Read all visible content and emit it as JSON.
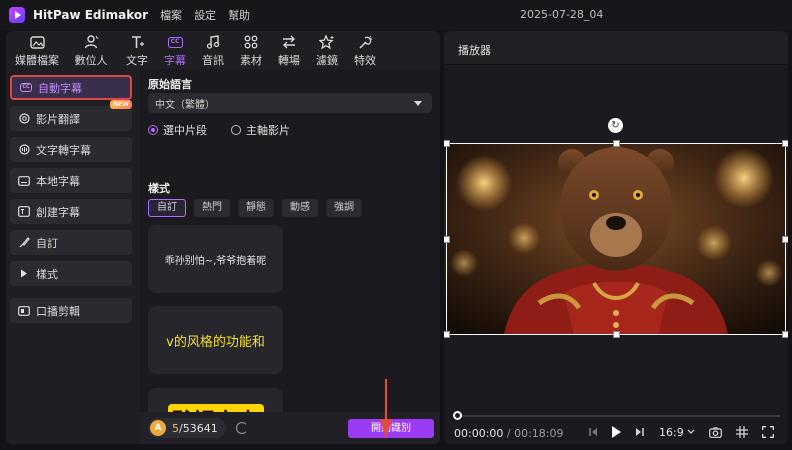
{
  "app": {
    "name": "HitPaw Edimakor",
    "menu": [
      "檔案",
      "設定",
      "幫助"
    ],
    "project_title": "2025-07-28_04"
  },
  "toolbar": {
    "items": [
      {
        "label": "媒體檔案",
        "icon": "media-icon"
      },
      {
        "label": "數位人",
        "icon": "avatar-icon"
      },
      {
        "label": "文字",
        "icon": "text-icon"
      },
      {
        "label": "字幕",
        "icon": "cc-icon",
        "active": true
      },
      {
        "label": "音訊",
        "icon": "music-icon"
      },
      {
        "label": "素材",
        "icon": "sticker-icon"
      },
      {
        "label": "轉場",
        "icon": "transition-icon"
      },
      {
        "label": "濾鏡",
        "icon": "filter-icon"
      },
      {
        "label": "特效",
        "icon": "effect-icon"
      }
    ]
  },
  "sidenav": {
    "items": [
      {
        "label": "自動字幕",
        "active": true
      },
      {
        "label": "影片翻譯",
        "badge": "NEW"
      },
      {
        "label": "文字轉字幕"
      },
      {
        "label": "本地字幕"
      },
      {
        "label": "創建字幕"
      },
      {
        "label": "自訂"
      },
      {
        "label": "樣式"
      },
      {
        "label": "口播剪輯"
      }
    ]
  },
  "subtitle_panel": {
    "source_language_label": "原始語言",
    "source_language_value": "中文（繁體）",
    "radio_selected_clip": "選中片段",
    "radio_main_video": "主軸影片",
    "style_label": "樣式",
    "style_tabs": [
      "自訂",
      "熱門",
      "靜態",
      "動感",
      "強調"
    ],
    "cards": [
      "乖孙别怕~,爷爷抱着呢",
      "v的风格的功能和",
      "默認文本"
    ]
  },
  "bottom_bar": {
    "credits_used": "5",
    "credits_total": "/53641",
    "start_button": "開始識別"
  },
  "player": {
    "title": "播放器",
    "current_time": "00:00:00",
    "total_time": "/ 00:18:09",
    "aspect_ratio": "16:9",
    "playhead_progress": 0
  },
  "colors": {
    "accent": "#9b3cf2",
    "highlight_box": "#e0454b",
    "arrow": "#e2493f"
  }
}
